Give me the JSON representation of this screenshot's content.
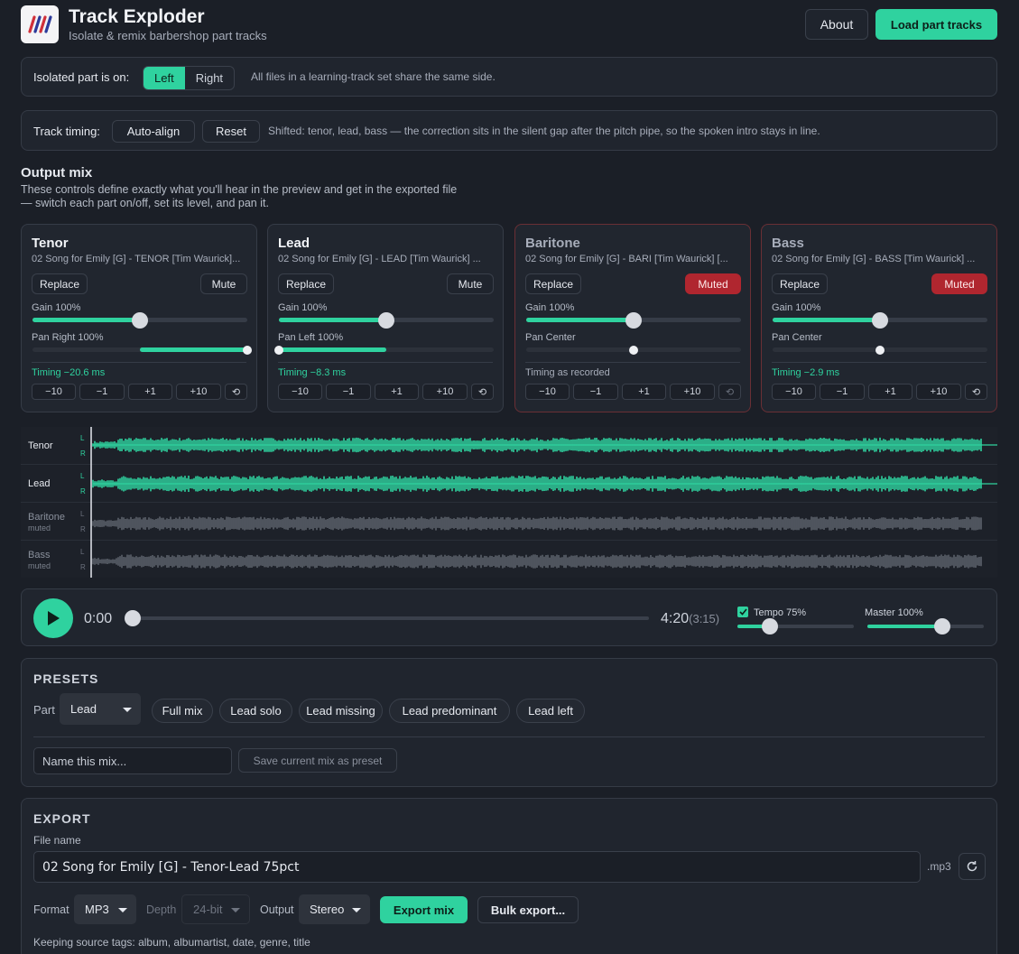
{
  "header": {
    "title": "Track Exploder",
    "subtitle": "Isolate & remix barbershop part tracks",
    "about_label": "About",
    "load_label": "Load part tracks"
  },
  "isolated": {
    "label": "Isolated part is on:",
    "left": "Left",
    "right": "Right",
    "selected": "Left",
    "note": "All files in a learning-track set share the same side."
  },
  "timing": {
    "label": "Track timing:",
    "auto_align": "Auto-align",
    "reset": "Reset",
    "note": "Shifted: tenor, lead, bass — the correction sits in the silent gap after the pitch pipe, so the spoken intro stays in line."
  },
  "output_mix": {
    "title": "Output mix",
    "desc_1": "These controls define exactly what you'll hear in the preview and get in the exported file",
    "desc_2": "— switch each part on/off, set its level, and pan it."
  },
  "parts": [
    {
      "name": "Tenor",
      "file": "02 Song for Emily [G] - TENOR [Tim Waurick]...",
      "replace": "Replace",
      "mute": "Mute",
      "muted": false,
      "gain_label": "Gain 100%",
      "gain": 1.0,
      "pan_label": "Pan Right 100%",
      "pan": 1.0,
      "timing": "Timing −20.6 ms",
      "nudges": [
        "−10",
        "−1",
        "+1",
        "+10",
        "⟲"
      ]
    },
    {
      "name": "Lead",
      "file": "02 Song for Emily [G] - LEAD [Tim Waurick] ...",
      "replace": "Replace",
      "mute": "Mute",
      "muted": false,
      "gain_label": "Gain 100%",
      "gain": 1.0,
      "pan_label": "Pan Left 100%",
      "pan": -1.0,
      "timing": "Timing −8.3 ms",
      "nudges": [
        "−10",
        "−1",
        "+1",
        "+10",
        "⟲"
      ]
    },
    {
      "name": "Baritone",
      "file": "02 Song for Emily [G] - BARI [Tim Waurick] [...",
      "replace": "Replace",
      "mute": "Muted",
      "muted": true,
      "gain_label": "Gain 100%",
      "gain": 1.0,
      "pan_label": "Pan Center",
      "pan": 0.0,
      "timing": "Timing as recorded",
      "nudges": [
        "−10",
        "−1",
        "+1",
        "+10",
        "⟲"
      ]
    },
    {
      "name": "Bass",
      "file": "02 Song for Emily [G] - BASS [Tim Waurick] ...",
      "replace": "Replace",
      "mute": "Muted",
      "muted": true,
      "gain_label": "Gain 100%",
      "gain": 1.0,
      "pan_label": "Pan Center",
      "pan": 0.0,
      "timing": "Timing −2.9 ms",
      "nudges": [
        "−10",
        "−1",
        "+1",
        "+10",
        "⟲"
      ]
    }
  ],
  "waveforms": [
    {
      "name": "Tenor",
      "sub": "",
      "muted": false
    },
    {
      "name": "Lead",
      "sub": "",
      "muted": false
    },
    {
      "name": "Baritone",
      "sub": "muted",
      "muted": true
    },
    {
      "name": "Bass",
      "sub": "muted",
      "muted": true
    }
  ],
  "channel_labels": {
    "left": "L",
    "right": "R"
  },
  "player": {
    "current": "0:00",
    "duration": "4:20",
    "duration_real": "(3:15)",
    "position": 0.0,
    "tempo_label": "Tempo 75%",
    "tempo_enabled": true,
    "tempo": 0.28,
    "master_label": "Master 100%",
    "master": 0.64
  },
  "presets": {
    "title": "PRESETS",
    "part_label": "Part",
    "part_value": "Lead",
    "buttons": [
      "Full mix",
      "Lead solo",
      "Lead missing",
      "Lead predominant",
      "Lead left"
    ],
    "name_placeholder": "Name this mix...",
    "save_label": "Save current mix as preset"
  },
  "export": {
    "title": "EXPORT",
    "file_name_label": "File name",
    "file_name": "02 Song for Emily [G] - Tenor-Lead 75pct",
    "ext": ".mp3",
    "format_label": "Format",
    "format": "MP3",
    "depth_label": "Depth",
    "depth": "24-bit",
    "output_label": "Output",
    "output": "Stereo",
    "export_label": "Export mix",
    "bulk_label": "Bulk export...",
    "tags_note": "Keeping source tags: album, albumartist, date, genre, title"
  },
  "colors": {
    "accent": "#2fd29f",
    "muted": "#b0262f",
    "bg": "#1b1f27"
  }
}
